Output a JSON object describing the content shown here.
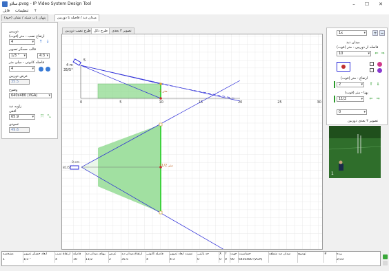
{
  "window": {
    "title": "سلاو.pvsg - IP Video System Design Tool",
    "minimize": "–",
    "maximize": "☐",
    "close": "✕"
  },
  "menu": {
    "file": "فایل",
    "settings": "تنظیمات",
    "extra": "؟"
  },
  "main_tabs": {
    "view": "میدان دید / فاصله تا دوربین",
    "blind": "پنهان یاب شیئه / نشان (خود)"
  },
  "sub_tabs": {
    "installation": "طرح نصب دوربین",
    "scheme": "طرح دکل",
    "view3d": "تصویر ۳ بعدی"
  },
  "left_panel": {
    "camera_label": "دوربین",
    "height_label": "ارتفاع نصب - متر (فوت)",
    "height_value": "4",
    "sensor_label": "قالب حسگر تصویر",
    "sensor_format": "1/3 \"",
    "aspect": "4:3",
    "focal_label": "فاصله کانونی - میلی متر",
    "focal_value": "4",
    "width_label": "عرض دوربین",
    "width_value": "35.5",
    "resolution_label": "وضوح",
    "resolution_value": "640x480 (VGA)",
    "fov_label": "زاویه دید",
    "horizontal_label": "افقی",
    "horizontal_value": "65.9",
    "vertical_label": "عمودی",
    "vertical_value": "49.6"
  },
  "right_panel": {
    "zoom_value": "1x",
    "view_field_label": "میدان دید",
    "distance_label": "فاصله از دوربین - متر (فوت)",
    "distance_value": "10",
    "target_height_label": "ارتفاع - متر (فوت)",
    "target_height_value": "2",
    "target_width_label": "پهنا - متر (فوت)",
    "target_width_value": "11/2",
    "angle_value": "0",
    "preview_label": "تصویر ۳ بعدی دوربین",
    "preview_index": "1"
  },
  "plot": {
    "camera_height_label": "4 m",
    "camera_angle_label": "35/5°",
    "target_label_top": "2 متر",
    "target_label_bottom": "11/2 متر",
    "camera_tag": "0 cm",
    "side_tag": "81/5°",
    "marker_top": "5"
  },
  "chart_data": {
    "type": "line",
    "x": [
      0,
      5,
      10,
      15,
      20,
      25,
      30
    ],
    "x_tick_labels": [
      "0",
      "5",
      "10",
      "15",
      "20",
      "25",
      "30"
    ],
    "xlim": [
      -1,
      30.5
    ],
    "grid": true
  },
  "table": {
    "headers": [
      "مشخصه",
      "ابعاد حسگر تصویر",
      "ارتفاع نصب",
      "فاصله",
      "پهنای میدان دید",
      "عرض",
      "ارتفاع میدان دید",
      "فاصله کانونی",
      "نسبت ابعاد تصویر",
      "حد پائینی",
      "X",
      "Y",
      "جهت",
      "حساسیت",
      "میدان دید منطقه",
      "توضیح",
      "#",
      "برده"
    ],
    "row": [
      "1",
      "1/3 \"",
      "4",
      "10",
      "11/2",
      "2",
      "35.5",
      "4",
      "4:3",
      "0",
      "0",
      "0",
      "90",
      "640x480 (VGA)",
      "",
      "",
      "",
      "2/33"
    ]
  },
  "colors": {
    "fov_fill": "#8fd98f",
    "target_line": "#22cc22",
    "ray": "#2a2ad8",
    "grid": "#e3e3e3"
  }
}
